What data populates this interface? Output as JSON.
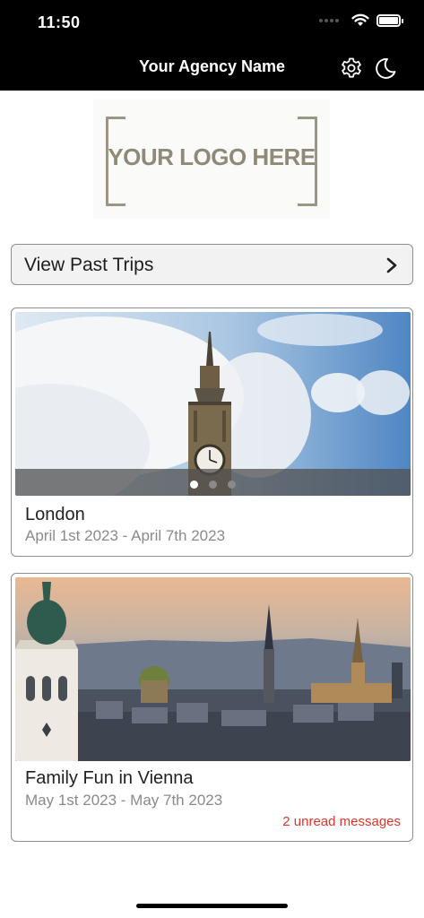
{
  "status_bar": {
    "time": "11:50",
    "icons": [
      "cellular-signal-icon",
      "wifi-icon",
      "battery-icon"
    ]
  },
  "nav": {
    "title": "Your Agency Name",
    "icons": [
      "gear-icon",
      "moon-icon"
    ]
  },
  "logo": {
    "text": "YOUR LOGO HERE"
  },
  "past_trips": {
    "label": "View Past Trips",
    "icon": "chevron-right-icon"
  },
  "trips": [
    {
      "title": "London",
      "dates": "April 1st 2023 - April 7th 2023",
      "image": "big-ben-clock-tower-photo",
      "carousel_pages": 3,
      "carousel_active": 1
    },
    {
      "title": "Family Fun in Vienna",
      "dates": "May 1st 2023 - May 7th 2023",
      "image": "vienna-city-skyline-photo",
      "unread": "2 unread messages"
    }
  ],
  "colors": {
    "header_bg": "#000000",
    "unread_text": "#e0342b",
    "logo_text": "#8f8a78"
  }
}
